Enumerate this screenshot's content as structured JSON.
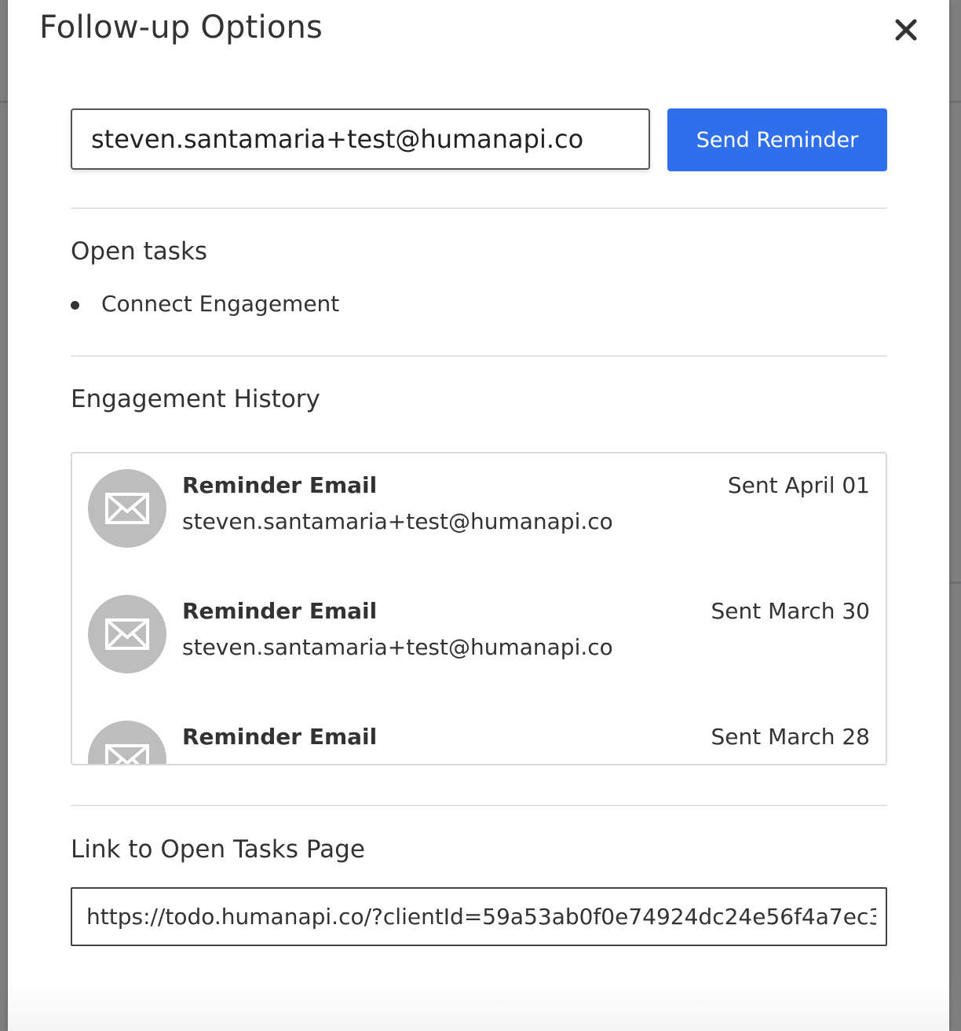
{
  "modal": {
    "title": "Follow-up Options"
  },
  "reminder": {
    "email_value": "steven.santamaria+test@humanapi.co",
    "send_label": "Send Reminder"
  },
  "open_tasks": {
    "heading": "Open tasks",
    "items": [
      "Connect Engagement"
    ]
  },
  "history": {
    "heading": "Engagement History",
    "entries": [
      {
        "type": "Reminder Email",
        "email": "steven.santamaria+test@humanapi.co",
        "date": "Sent April 01",
        "icon": "mail-icon"
      },
      {
        "type": "Reminder Email",
        "email": "steven.santamaria+test@humanapi.co",
        "date": "Sent March 30",
        "icon": "mail-icon"
      },
      {
        "type": "Reminder Email",
        "email": "",
        "date": "Sent March 28",
        "icon": "mail-icon"
      }
    ]
  },
  "link": {
    "heading": "Link to Open Tasks Page",
    "url": "https://todo.humanapi.co/?clientId=59a53ab0f0e74924dc24e56f4a7ec3"
  },
  "colors": {
    "primary_button": "#2f6fec",
    "avatar_bg": "#bdbdbd",
    "text": "#333333"
  }
}
